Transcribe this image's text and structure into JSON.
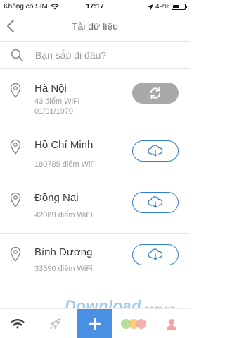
{
  "status_bar": {
    "carrier": "Không có SIM",
    "time": "17:17",
    "battery_percent": "49%",
    "battery_level": 0.49
  },
  "nav": {
    "title": "Tải dữ liệu"
  },
  "search": {
    "placeholder": "Bạn sắp đi đâu?",
    "value": ""
  },
  "cities": [
    {
      "name": "Hà Nội",
      "count": "43 điểm WiFi",
      "date": "01/01/1970",
      "action": "sync"
    },
    {
      "name": "Hồ Chí Minh",
      "count": "180785 điểm WiFi",
      "date": "",
      "action": "download"
    },
    {
      "name": "Đồng Nai",
      "count": "42089 điểm WiFi",
      "date": "",
      "action": "download"
    },
    {
      "name": "Bình Dương",
      "count": "33590 điểm WiFi",
      "date": "",
      "action": "download"
    }
  ],
  "colors": {
    "accent": "#2f7fd0",
    "tab_add_bg": "#4a90e2",
    "sync_button": "#a9a9a9"
  },
  "tabs": [
    {
      "icon": "wifi-icon"
    },
    {
      "icon": "rocket-icon"
    },
    {
      "icon": "plus-icon"
    },
    {
      "icon": "hearts-icon"
    },
    {
      "icon": "profile-icon"
    }
  ],
  "watermark": {
    "text": "Download",
    "suffix": ".com.vn"
  }
}
